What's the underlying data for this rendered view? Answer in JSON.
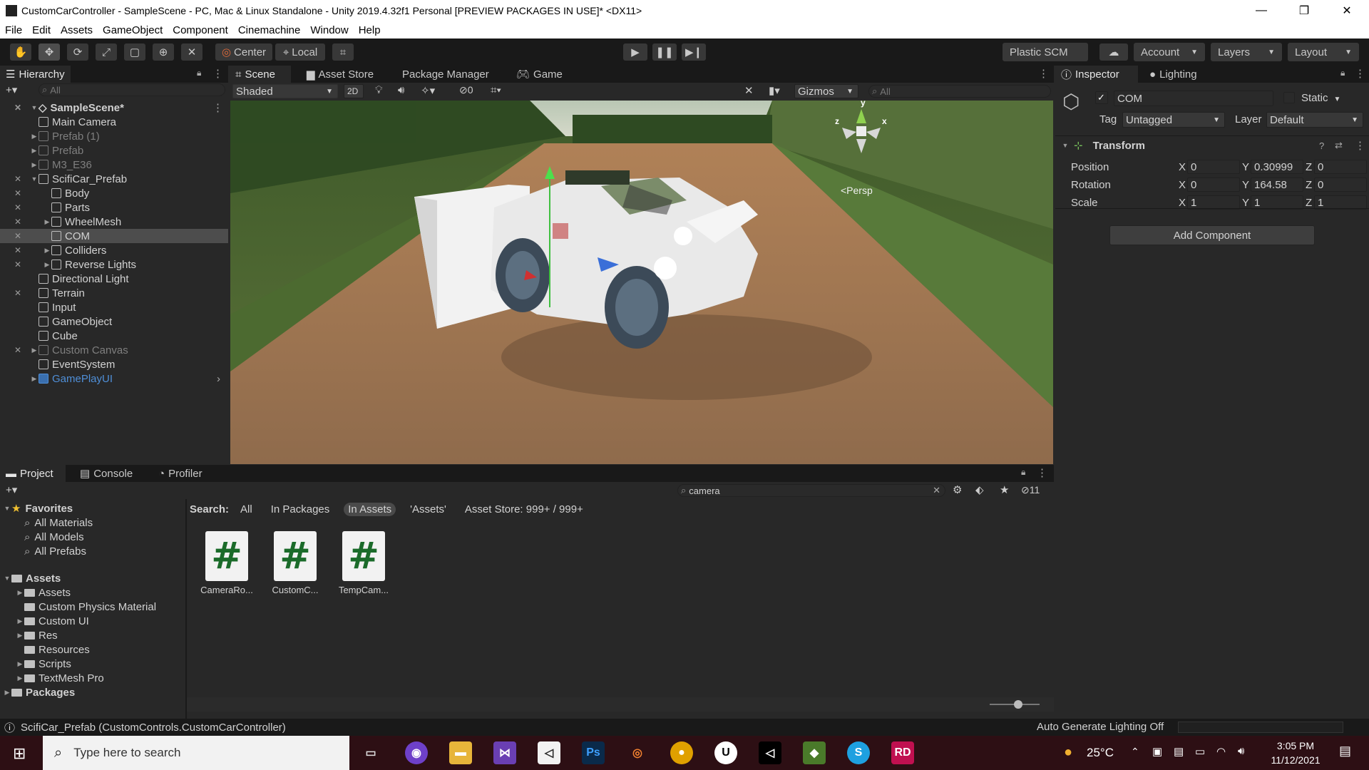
{
  "window": {
    "title": "CustomCarController - SampleScene - PC, Mac & Linux Standalone - Unity 2019.4.32f1 Personal [PREVIEW PACKAGES IN USE]* <DX11>",
    "minimize": "—",
    "maximize": "❐",
    "close": "✕"
  },
  "menu": [
    "File",
    "Edit",
    "Assets",
    "GameObject",
    "Component",
    "Cinemachine",
    "Window",
    "Help"
  ],
  "toolbar": {
    "pivot": "Center",
    "space": "Local",
    "plastic": "Plastic SCM",
    "account": "Account",
    "layers": "Layers",
    "layout": "Layout"
  },
  "hierarchy": {
    "tab": "Hierarchy",
    "search_placeholder": "All",
    "scene": "SampleScene*",
    "items": [
      {
        "label": "Main Camera",
        "indent": 1,
        "fold": false,
        "state": "normal",
        "eye": false
      },
      {
        "label": "Prefab (1)",
        "indent": 1,
        "fold": true,
        "state": "dim",
        "eye": false
      },
      {
        "label": "Prefab",
        "indent": 1,
        "fold": true,
        "state": "dim",
        "eye": false
      },
      {
        "label": "M3_E36",
        "indent": 1,
        "fold": true,
        "state": "dim",
        "eye": false
      },
      {
        "label": "ScifiCar_Prefab",
        "indent": 1,
        "fold": "open",
        "state": "normal",
        "eye": true
      },
      {
        "label": "Body",
        "indent": 2,
        "fold": false,
        "state": "normal",
        "eye": true
      },
      {
        "label": "Parts",
        "indent": 2,
        "fold": false,
        "state": "normal",
        "eye": true
      },
      {
        "label": "WheelMesh",
        "indent": 2,
        "fold": true,
        "state": "normal",
        "eye": true
      },
      {
        "label": "COM",
        "indent": 2,
        "fold": false,
        "state": "selected",
        "eye": true
      },
      {
        "label": "Colliders",
        "indent": 2,
        "fold": true,
        "state": "normal",
        "eye": true
      },
      {
        "label": "Reverse Lights",
        "indent": 2,
        "fold": true,
        "state": "normal",
        "eye": true
      },
      {
        "label": "Directional Light",
        "indent": 1,
        "fold": false,
        "state": "normal",
        "eye": false
      },
      {
        "label": "Terrain",
        "indent": 1,
        "fold": false,
        "state": "normal",
        "eye": true
      },
      {
        "label": "Input",
        "indent": 1,
        "fold": false,
        "state": "normal",
        "eye": false
      },
      {
        "label": "GameObject",
        "indent": 1,
        "fold": false,
        "state": "normal",
        "eye": false
      },
      {
        "label": "Cube",
        "indent": 1,
        "fold": false,
        "state": "normal",
        "eye": false
      },
      {
        "label": "Custom Canvas",
        "indent": 1,
        "fold": true,
        "state": "dim",
        "eye": true
      },
      {
        "label": "EventSystem",
        "indent": 1,
        "fold": false,
        "state": "normal",
        "eye": false
      },
      {
        "label": "GamePlayUI",
        "indent": 1,
        "fold": true,
        "state": "blue",
        "eye": false
      }
    ]
  },
  "scene_tabs": {
    "scene": "Scene",
    "asset_store": "Asset Store",
    "package_manager": "Package Manager",
    "game": "Game"
  },
  "scene_toolbar": {
    "shading": "Shaded",
    "mode2d": "2D",
    "hidden_count": "0",
    "gizmos": "Gizmos",
    "search_placeholder": "All"
  },
  "gizmo": {
    "x": "x",
    "y": "y",
    "z": "z",
    "persp": "<Persp"
  },
  "inspector": {
    "tab": "Inspector",
    "lighting_tab": "Lighting",
    "object_name": "COM",
    "static_label": "Static",
    "tag_label": "Tag",
    "tag_value": "Untagged",
    "layer_label": "Layer",
    "layer_value": "Default",
    "component": "Transform",
    "position": {
      "label": "Position",
      "x": "0",
      "y": "0.30999",
      "z": "0"
    },
    "rotation": {
      "label": "Rotation",
      "x": "0",
      "y": "164.58",
      "z": "0"
    },
    "scale": {
      "label": "Scale",
      "x": "1",
      "y": "1",
      "z": "1"
    },
    "add_component": "Add Component",
    "axis_x": "X",
    "axis_y": "Y",
    "axis_z": "Z"
  },
  "bottom_tabs": {
    "project": "Project",
    "console": "Console",
    "profiler": "Profiler"
  },
  "project": {
    "favorites": "Favorites",
    "favorite_items": [
      "All Materials",
      "All Models",
      "All Prefabs"
    ],
    "assets_root": "Assets",
    "asset_folders": [
      {
        "label": "Assets",
        "fold": true
      },
      {
        "label": "Custom Physics Material",
        "fold": false
      },
      {
        "label": "Custom UI",
        "fold": true
      },
      {
        "label": "Res",
        "fold": true
      },
      {
        "label": "Resources",
        "fold": false
      },
      {
        "label": "Scripts",
        "fold": true
      },
      {
        "label": "TextMesh Pro",
        "fold": true
      }
    ],
    "packages": "Packages",
    "search_value": "camera",
    "search_label": "Search:",
    "filters": [
      "All",
      "In Packages",
      "In Assets",
      "'Assets'",
      "Asset Store: 999+ / 999+"
    ],
    "active_filter": "In Assets",
    "hidden_count": "11",
    "assets": [
      {
        "name": "CameraRo...",
        "glyph": "#"
      },
      {
        "name": "CustomC...",
        "glyph": "#"
      },
      {
        "name": "TempCam...",
        "glyph": "#"
      }
    ]
  },
  "status": {
    "message": "ScifiCar_Prefab (CustomControls.CustomCarController)",
    "lighting": "Auto Generate Lighting Off"
  },
  "taskbar": {
    "search_placeholder": "Type here to search",
    "temperature": "25°C",
    "time": "3:05 PM",
    "date": "11/12/2021",
    "apps": [
      "task-view",
      "github",
      "file-explorer",
      "visual-studio",
      "unity-hub",
      "photoshop",
      "blender",
      "chrome",
      "unreal",
      "unity",
      "android",
      "skype",
      "rider"
    ]
  }
}
